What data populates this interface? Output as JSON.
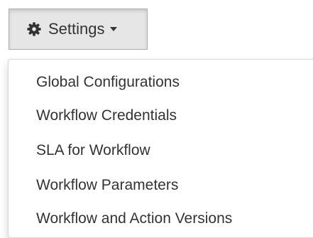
{
  "button": {
    "label": "Settings",
    "icon": "gear-icon",
    "caret_icon": "caret-down-icon"
  },
  "menu": {
    "items": [
      {
        "label": "Global Configurations"
      },
      {
        "label": "Workflow Credentials"
      },
      {
        "label": "SLA for Workflow"
      },
      {
        "label": "Workflow Parameters"
      },
      {
        "label": "Workflow and Action Versions"
      }
    ]
  },
  "colors": {
    "button_bg": "#e6e6e6",
    "button_border": "#adadad",
    "text": "#333333",
    "menu_bg": "#ffffff"
  }
}
